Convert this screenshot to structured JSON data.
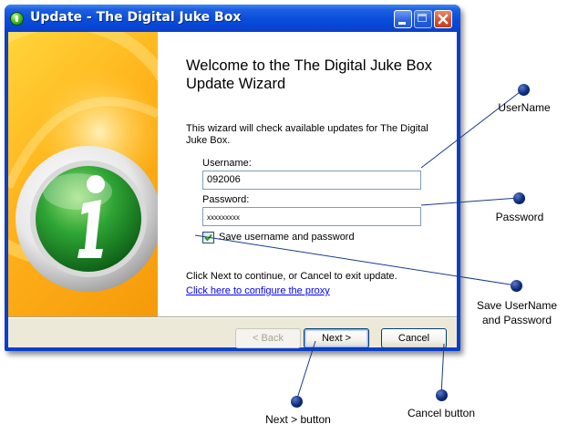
{
  "window": {
    "title": "Update - The Digital Juke Box"
  },
  "wizard": {
    "heading": "Welcome to the The Digital Juke Box Update Wizard",
    "description": "This wizard will check available updates for The Digital Juke Box.",
    "username_label": "Username:",
    "username_value": "092006",
    "password_label": "Password:",
    "password_value": "xxxxxxxxx",
    "save_checkbox_label": "Save username and password",
    "save_checked": true,
    "hint": "Click Next to continue, or Cancel to exit update.",
    "proxy_link": "Click here to configure the proxy"
  },
  "buttons": {
    "back": "< Back",
    "next": "Next >",
    "cancel": "Cancel"
  },
  "annotations": {
    "username": "UserName",
    "password": "Password",
    "save_line1": "Save UserName",
    "save_line2": "and Password",
    "next": "Next > button",
    "cancel": "Cancel button"
  },
  "colors": {
    "titlebar": "#0a4fdc",
    "banner_orange": "#ffb21a",
    "info_green": "#2fa535",
    "annotation_dot": "#0b2b7a"
  },
  "icons": {
    "app": "green-info-icon",
    "banner": "large-info-icon"
  }
}
